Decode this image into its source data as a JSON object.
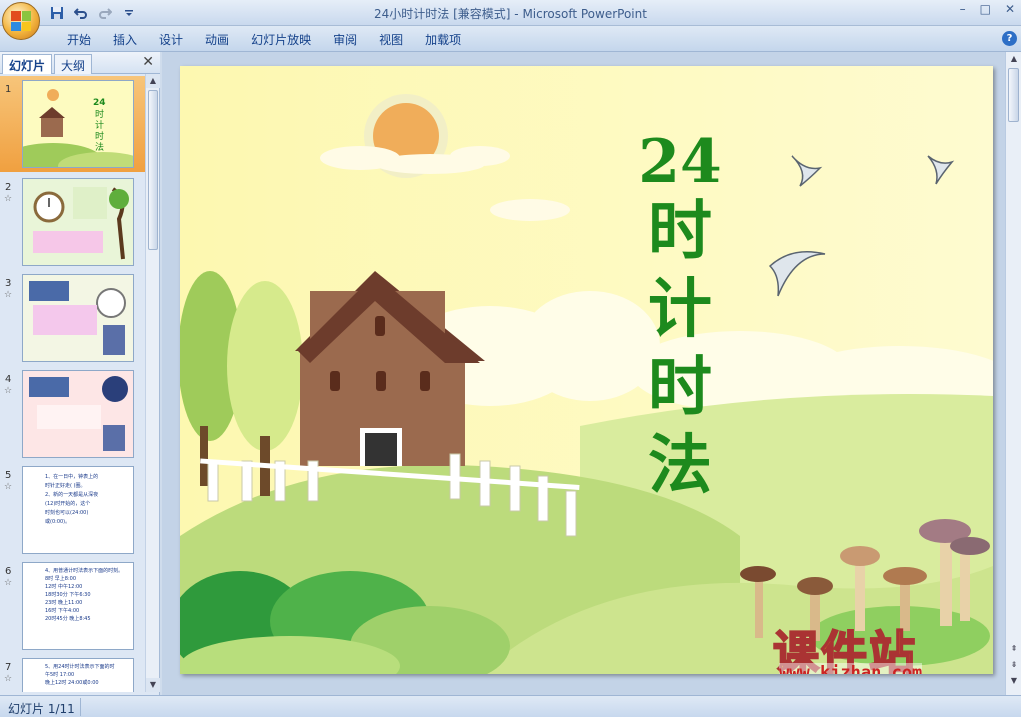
{
  "window": {
    "title": "24小时计时法 [兼容模式] - Microsoft PowerPoint",
    "controls": [
      "–",
      "□",
      "✕"
    ]
  },
  "ribbon": {
    "tabs": [
      "开始",
      "插入",
      "设计",
      "动画",
      "幻灯片放映",
      "审阅",
      "视图",
      "加载项"
    ],
    "help": "?"
  },
  "quick_access": {
    "icons": [
      "save-icon",
      "undo-icon",
      "redo-icon",
      "customize-icon"
    ]
  },
  "pane": {
    "tabs": [
      "幻灯片",
      "大纲"
    ],
    "close": "✕"
  },
  "slides": [
    {
      "num": "1",
      "star": ""
    },
    {
      "num": "2",
      "star": "☆"
    },
    {
      "num": "3",
      "star": "☆"
    },
    {
      "num": "4",
      "star": "☆"
    },
    {
      "num": "5",
      "star": "☆"
    },
    {
      "num": "6",
      "star": "☆"
    },
    {
      "num": "7",
      "star": "☆"
    }
  ],
  "thumb_texts": {
    "t5": {
      "line1": "1、在一日中，钟表上的",
      "line2": "时针正好走(  )圈。",
      "line3": "2、新的一天都是从深夜",
      "line4": "(12)时开始的，这个",
      "line5": "时刻也可以(24:00)",
      "line6": "或(0:00)。"
    },
    "t6": {
      "line1": "4、用普通计时法表示下面的时刻。",
      "rows": [
        "8时  早上8:00",
        "12时  中午12:00",
        "18时30分  下午6:30",
        "23时  晚上11:00",
        "16时  下午4:00",
        "20时45分  晚上8:45"
      ]
    },
    "t7": {
      "line1": "5、用24时计时法表示下面的时",
      "line2": "午5时  17:00",
      "line3": "晚上12时  24:00或0:00"
    }
  },
  "slide_main": {
    "title_number": "24",
    "title_chars": [
      "时",
      "计",
      "时",
      "法"
    ],
    "title_color": "#1d8a1d"
  },
  "watermark": {
    "text": "课件站",
    "url": "www.kjzhan.com"
  },
  "status": {
    "slide_indicator": "幻灯片 1/11"
  },
  "colors": {
    "selected_thumb": "#f0a040",
    "ribbon_text": "#15428b"
  }
}
